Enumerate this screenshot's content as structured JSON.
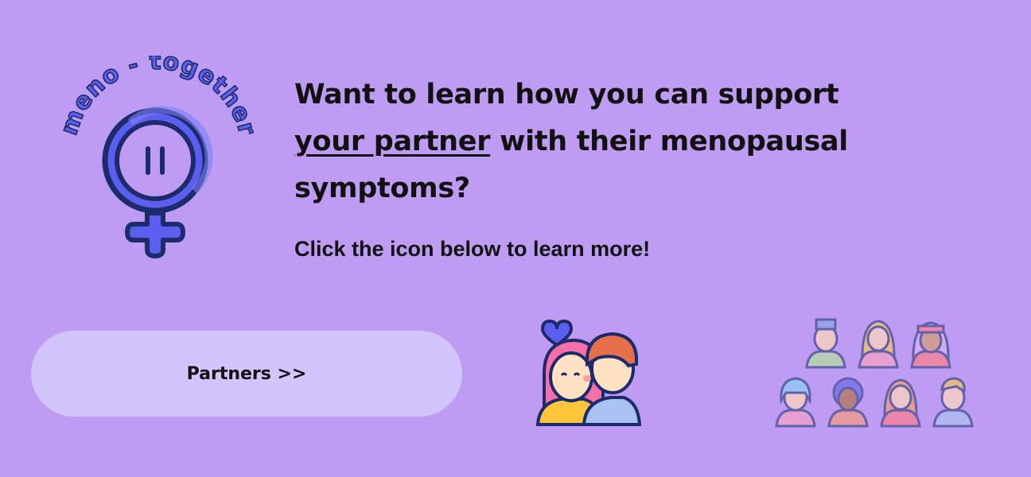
{
  "logo": {
    "arc_text": "meno - together"
  },
  "headline": {
    "part1": "Want to learn how you can support ",
    "underlined": "your partner",
    "part2": " with their menopausal symptoms?"
  },
  "subtext": "Click the icon below to learn more!",
  "partners_button": {
    "label": "Partners >>"
  },
  "colors": {
    "background": "#bf9cf3",
    "button": "#d2c5fb",
    "logo_blue": "#5b5ff0",
    "logo_navy": "#1d2b6b"
  },
  "icons": [
    "venus-logo-icon",
    "couple-heart-icon",
    "people-group-icon"
  ]
}
